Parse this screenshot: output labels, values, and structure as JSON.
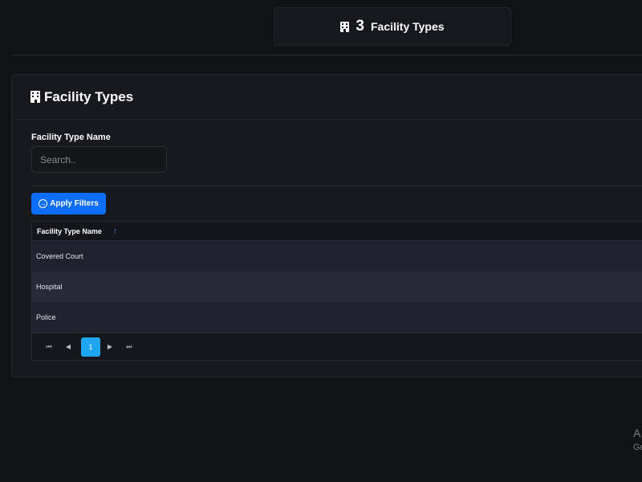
{
  "stat_card": {
    "count": "3",
    "label": "Facility Types",
    "icon": "building-icon"
  },
  "panel": {
    "title": "Facility Types",
    "icon": "building-icon"
  },
  "filters": {
    "label": "Facility Type Name",
    "placeholder": "Search..",
    "apply_label": "Apply Filters"
  },
  "table": {
    "columns": [
      {
        "label": "Facility Type Name",
        "sort": "ascending"
      }
    ],
    "rows": [
      "Covered Court",
      "Hospital",
      "Police"
    ]
  },
  "pagination": {
    "first": "⏮",
    "prev": "◀",
    "next": "▶",
    "last": "⏭",
    "current_page": "1"
  },
  "watermark": {
    "line1": "A",
    "line2": "Go"
  },
  "colors": {
    "accent": "#0d6efd",
    "page_active": "#1fa6f2",
    "sort_icon": "#3b82f6"
  }
}
